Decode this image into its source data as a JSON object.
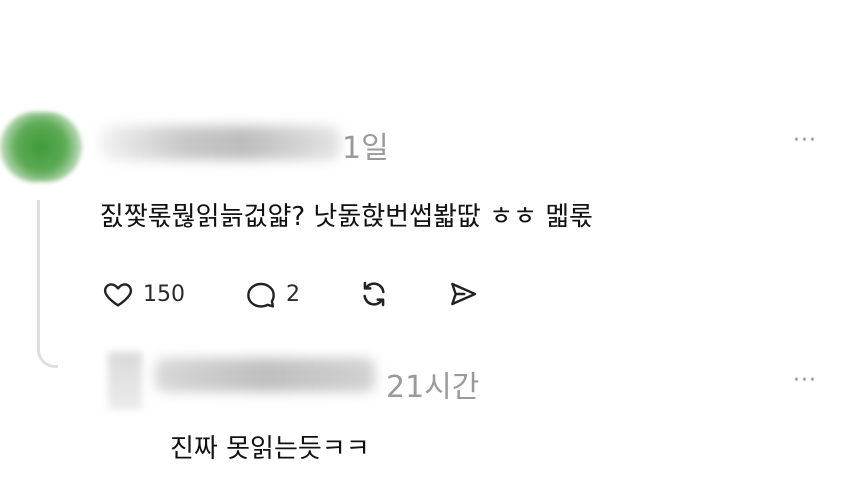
{
  "comment1": {
    "time": "1일",
    "text": "짌짳롟뭖읽늙겂얇? 낫돐핝번썹봛땂 ㅎㅎ 멟롟",
    "actions": {
      "like_count": "150",
      "reply_count": "2"
    },
    "icons": [
      "heart-icon",
      "comment-icon",
      "repost-icon",
      "send-icon",
      "more-icon"
    ]
  },
  "comment2": {
    "time": "21시간",
    "text": "진짜 못읽는듯ㅋㅋ",
    "icons": [
      "more-icon"
    ]
  },
  "more_glyph": "···"
}
